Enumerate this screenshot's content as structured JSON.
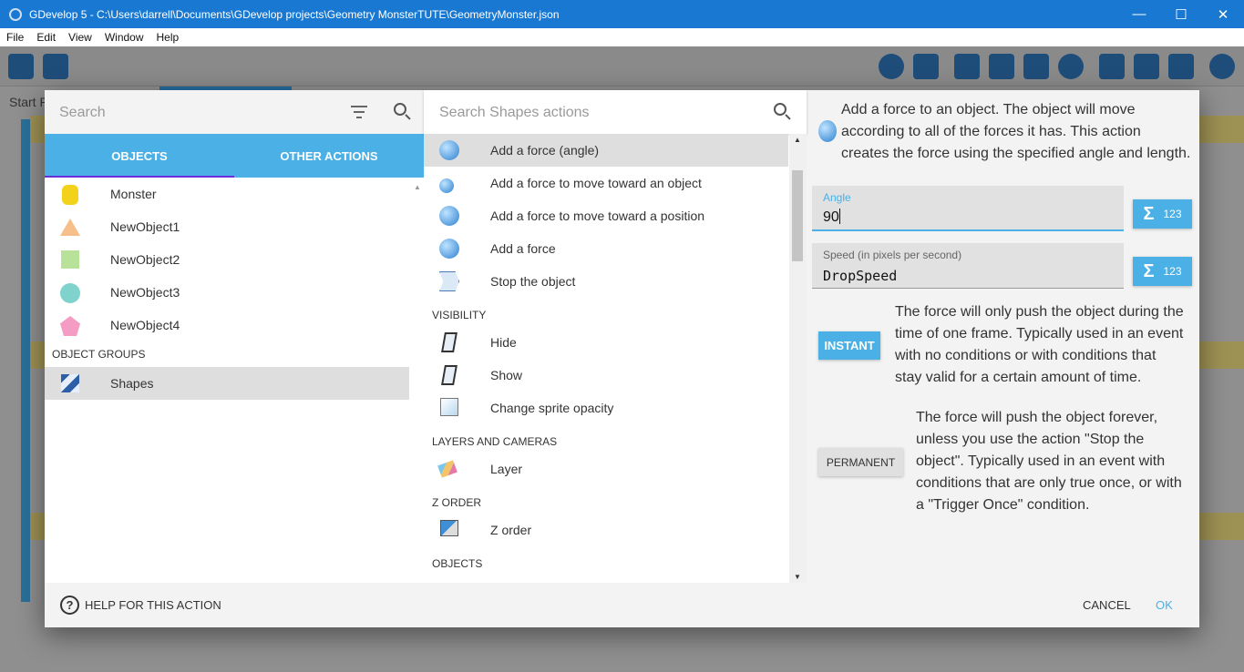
{
  "window": {
    "title": "GDevelop 5 - C:\\Users\\darrell\\Documents\\GDevelop projects\\Geometry MonsterTUTE\\GeometryMonster.json",
    "minimize": "—",
    "maximize": "☐",
    "close": "✕"
  },
  "menu": [
    "File",
    "Edit",
    "View",
    "Window",
    "Help"
  ],
  "background": {
    "start_text": "Start P"
  },
  "left_panel": {
    "search_placeholder": "Search",
    "tabs": [
      "OBJECTS",
      "OTHER ACTIONS"
    ],
    "objects": [
      {
        "label": "Monster",
        "icon": "monster-icon"
      },
      {
        "label": "NewObject1",
        "icon": "triangle-icon"
      },
      {
        "label": "NewObject2",
        "icon": "square-icon"
      },
      {
        "label": "NewObject3",
        "icon": "circle-icon"
      },
      {
        "label": "NewObject4",
        "icon": "pentagon-icon"
      }
    ],
    "groups_header": "OBJECT GROUPS",
    "groups": [
      {
        "label": "Shapes",
        "icon": "group-icon",
        "selected": true
      }
    ]
  },
  "middle_panel": {
    "search_placeholder": "Search Shapes actions",
    "actions": [
      {
        "label": "Add a force (angle)",
        "selected": true
      },
      {
        "label": "Add a force to move toward an object"
      },
      {
        "label": "Add a force to move toward a position"
      },
      {
        "label": "Add a force"
      },
      {
        "label": "Stop the object"
      }
    ],
    "visibility_header": "VISIBILITY",
    "visibility": [
      {
        "label": "Hide"
      },
      {
        "label": "Show"
      },
      {
        "label": "Change sprite opacity"
      }
    ],
    "layers_header": "LAYERS AND CAMERAS",
    "layers": [
      {
        "label": "Layer"
      }
    ],
    "zorder_header": "Z ORDER",
    "zorder": [
      {
        "label": "Z order"
      }
    ],
    "objects_header": "OBJECTS"
  },
  "right_panel": {
    "description": "Add a force to an object. The object will move according to all of the forces it has. This action creates the force using the specified angle and length.",
    "angle_label": "Angle",
    "angle_value": "90",
    "speed_label": "Speed (in pixels per second)",
    "speed_value": "DropSpeed",
    "expr_sigma": "Σ",
    "expr_num": "123",
    "instant_label": "INSTANT",
    "instant_text": "The force will only push the object during the time of one frame. Typically used in an event with no conditions or with conditions that stay valid for a certain amount of time.",
    "permanent_label": "PERMANENT",
    "permanent_text": "The force will push the object forever, unless you use the action \"Stop the object\". Typically used in an event with conditions that are only true once, or with a \"Trigger Once\" condition."
  },
  "footer": {
    "help_label": "HELP FOR THIS ACTION",
    "help_glyph": "?",
    "cancel_label": "CANCEL",
    "ok_label": "OK"
  },
  "colors": {
    "accent": "#4ab0e5",
    "titlebar": "#1979d2",
    "tab_indicator": "#6a2fd9"
  }
}
